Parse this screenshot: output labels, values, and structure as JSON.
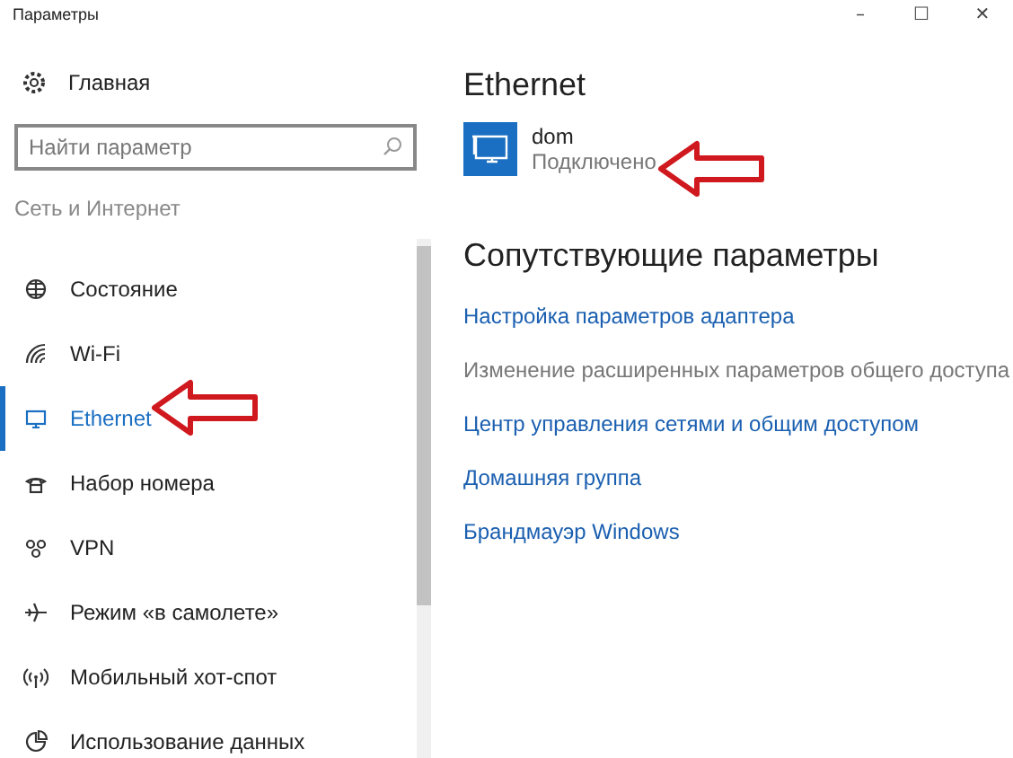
{
  "window": {
    "title": "Параметры",
    "controls": [
      "–",
      "☐",
      "✕"
    ]
  },
  "sidebar": {
    "home": "Главная",
    "search": {
      "placeholder": "Найти параметр"
    },
    "section": "Сеть и Интернет",
    "items": [
      {
        "label": "Состояние",
        "kind": "status",
        "selected": false
      },
      {
        "label": "Wi-Fi",
        "kind": "wifi",
        "selected": false
      },
      {
        "label": "Ethernet",
        "kind": "ethernet",
        "selected": true
      },
      {
        "label": "Набор номера",
        "kind": "dialup",
        "selected": false
      },
      {
        "label": "VPN",
        "kind": "vpn",
        "selected": false
      },
      {
        "label": "Режим «в самолете»",
        "kind": "plane",
        "selected": false
      },
      {
        "label": "Мобильный хот-спот",
        "kind": "hotspot",
        "selected": false
      },
      {
        "label": "Использование данных",
        "kind": "data",
        "selected": false
      }
    ]
  },
  "content": {
    "title": "Ethernet",
    "connection": {
      "name": "dom",
      "status": "Подключено"
    },
    "related_title": "Сопутствующие параметры",
    "links": [
      {
        "label": "Настройка параметров адаптера",
        "disabled": false
      },
      {
        "label": "Изменение расширенных параметров общего доступа",
        "disabled": true
      },
      {
        "label": "Центр управления сетями и общим доступом",
        "disabled": false
      },
      {
        "label": "Домашняя группа",
        "disabled": false
      },
      {
        "label": "Брандмауэр Windows",
        "disabled": false
      }
    ]
  }
}
